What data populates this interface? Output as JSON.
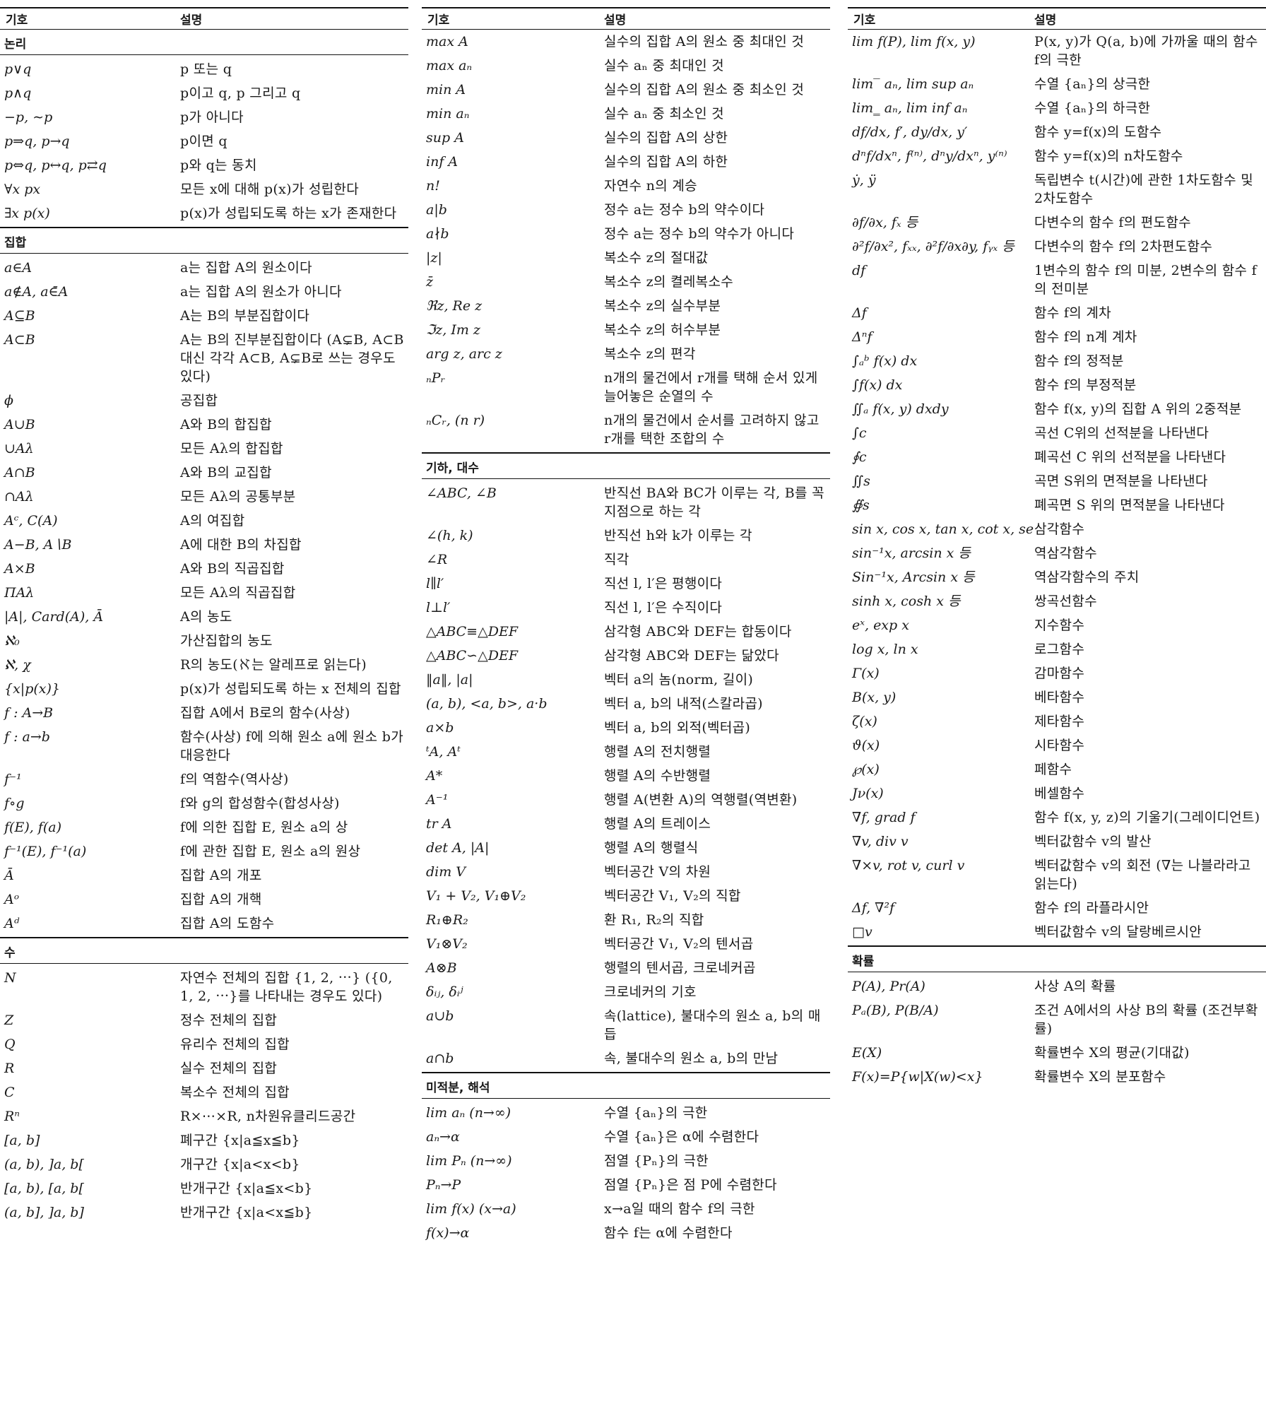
{
  "header": {
    "symbol_label": "기호",
    "desc_label": "설명"
  },
  "columns": [
    {
      "sections": [
        {
          "title": "논리",
          "rows": [
            {
              "sym": "p∨q",
              "desc": "p 또는 q"
            },
            {
              "sym": "p∧q",
              "desc": "p이고 q, p 그리고 q"
            },
            {
              "sym": "−p, ∼p",
              "desc": "p가 아니다"
            },
            {
              "sym": "p⇒q, p→q",
              "desc": "p이면 q"
            },
            {
              "sym": "p⇔q, p↔q, p⇄q",
              "desc": "p와 q는 동치"
            },
            {
              "sym": "∀x px",
              "desc": "모든 x에 대해 p(x)가 성립한다"
            },
            {
              "sym": "∃x p(x)",
              "desc": "p(x)가 성립되도록 하는 x가 존재한다"
            }
          ]
        },
        {
          "title": "집합",
          "rows": [
            {
              "sym": "a∈A",
              "desc": "a는 집합 A의 원소이다"
            },
            {
              "sym": "a∉A, a∈̄A",
              "desc": "a는 집합 A의 원소가 아니다"
            },
            {
              "sym": "A⊆B",
              "desc": "A는 B의 부분집합이다"
            },
            {
              "sym": "A⊂B",
              "desc": "A는 B의 진부분집합이다 (A⊊B, A⊂B 대신 각각 A⊂B, A⊊B로 쓰는 경우도 있다)"
            },
            {
              "sym": "ϕ",
              "desc": "공집합"
            },
            {
              "sym": "A∪B",
              "desc": "A와 B의 합집합"
            },
            {
              "sym": "∪Aλ",
              "desc": "모든 Aλ의 합집합"
            },
            {
              "sym": "A∩B",
              "desc": "A와 B의 교집합"
            },
            {
              "sym": "∩Aλ",
              "desc": "모든 Aλ의 공통부분"
            },
            {
              "sym": "Aᶜ, C(A)",
              "desc": "A의 여집합"
            },
            {
              "sym": "A−B, A∖B",
              "desc": "A에 대한 B의 차집합"
            },
            {
              "sym": "A×B",
              "desc": "A와 B의 직곱집합"
            },
            {
              "sym": "ΠAλ",
              "desc": "모든 Aλ의 직곱집합"
            },
            {
              "sym": "|A|, Card(A), Ā",
              "desc": "A의 농도"
            },
            {
              "sym": "ℵ₀",
              "desc": "가산집합의 농도"
            },
            {
              "sym": "ℵ, χ",
              "desc": "R의 농도(ℵ는 알레프로 읽는다)"
            },
            {
              "sym": "{x|p(x)}",
              "desc": "p(x)가 성립되도록 하는 x 전체의 집합"
            },
            {
              "sym": "f : A→B",
              "desc": "집합 A에서 B로의 함수(사상)"
            },
            {
              "sym": "f : a→b",
              "desc": "함수(사상) f에 의해 원소 a에 원소 b가 대응한다"
            },
            {
              "sym": "f⁻¹",
              "desc": "f의 역함수(역사상)"
            },
            {
              "sym": "f∘g",
              "desc": "f와 g의 합성함수(합성사상)"
            },
            {
              "sym": "f(E), f(a)",
              "desc": "f에 의한 집합 E, 원소 a의 상"
            },
            {
              "sym": "f⁻¹(E), f⁻¹(a)",
              "desc": "f에 관한 집합 E, 원소 a의 원상"
            },
            {
              "sym": "Ā",
              "desc": "집합 A의 개포"
            },
            {
              "sym": "Aᵒ",
              "desc": "집합 A의 개핵"
            },
            {
              "sym": "Aᵈ",
              "desc": "집합 A의 도함수"
            }
          ]
        },
        {
          "title": "수",
          "rows": [
            {
              "sym": "N",
              "desc": "자연수 전체의 집합 {1, 2, ⋯} ({0, 1, 2, ⋯}를 나타내는 경우도 있다)"
            },
            {
              "sym": "Z",
              "desc": "정수 전체의 집합"
            },
            {
              "sym": "Q",
              "desc": "유리수 전체의 집합"
            },
            {
              "sym": "R",
              "desc": "실수 전체의 집합"
            },
            {
              "sym": "C",
              "desc": "복소수 전체의 집합"
            },
            {
              "sym": "Rⁿ",
              "desc": "R×⋯×R, n차원유클리드공간"
            },
            {
              "sym": "[a, b]",
              "desc": "폐구간 {x|a≦x≦b}"
            },
            {
              "sym": "(a, b), ]a, b[",
              "desc": "개구간 {x|a<x<b}"
            },
            {
              "sym": "[a, b), [a, b[",
              "desc": "반개구간 {x|a≦x<b}"
            },
            {
              "sym": "(a, b], ]a, b]",
              "desc": "반개구간 {x|a<x≦b}"
            }
          ]
        }
      ]
    },
    {
      "sections": [
        {
          "title": "",
          "rows": [
            {
              "sym": "max A",
              "desc": "실수의 집합 A의 원소 중 최대인 것"
            },
            {
              "sym": "max aₙ",
              "desc": "실수 aₙ 중 최대인 것"
            },
            {
              "sym": "min A",
              "desc": "실수의 집합 A의 원소 중 최소인 것"
            },
            {
              "sym": "min aₙ",
              "desc": "실수 aₙ 중 최소인 것"
            },
            {
              "sym": "sup A",
              "desc": "실수의 집합 A의 상한"
            },
            {
              "sym": "inf A",
              "desc": "실수의 집합 A의 하한"
            },
            {
              "sym": "n!",
              "desc": "자연수 n의 계승"
            },
            {
              "sym": "a|b",
              "desc": "정수 a는 정수 b의 약수이다"
            },
            {
              "sym": "a∤b",
              "desc": "정수 a는 정수 b의 약수가 아니다"
            },
            {
              "sym": "|z|",
              "desc": "복소수 z의 절대값"
            },
            {
              "sym": "z̄",
              "desc": "복소수 z의 켤레복소수"
            },
            {
              "sym": "ℜz, Re z",
              "desc": "복소수 z의 실수부분"
            },
            {
              "sym": "ℑz, Im z",
              "desc": "복소수 z의 허수부분"
            },
            {
              "sym": "arg z, arc z",
              "desc": "복소수 z의 편각"
            },
            {
              "sym": "ₙPᵣ",
              "desc": "n개의 물건에서 r개를 택해 순서 있게 늘어놓은 순열의 수"
            },
            {
              "sym": "ₙCᵣ, (n r)",
              "desc": "n개의 물건에서 순서를 고려하지 않고 r개를 택한 조합의 수"
            }
          ]
        },
        {
          "title": "기하, 대수",
          "rows": [
            {
              "sym": "∠ABC, ∠B",
              "desc": "반직선 BA와 BC가 이루는 각, B를 꼭지점으로 하는 각"
            },
            {
              "sym": "∠(h, k)",
              "desc": "반직선 h와 k가 이루는 각"
            },
            {
              "sym": "∠R",
              "desc": "직각"
            },
            {
              "sym": "l∥l′",
              "desc": "직선 l, l′은 평행이다"
            },
            {
              "sym": "l⊥l′",
              "desc": "직선 l, l′은 수직이다"
            },
            {
              "sym": "△ABC≡△DEF",
              "desc": "삼각형 ABC와 DEF는 합동이다"
            },
            {
              "sym": "△ABC∽△DEF",
              "desc": "삼각형 ABC와 DEF는 닮았다"
            },
            {
              "sym": "‖a‖, |a|",
              "desc": "벡터 a의 놈(norm, 길이)"
            },
            {
              "sym": "(a, b), <a, b>, a·b",
              "desc": "벡터 a, b의 내적(스칼라곱)"
            },
            {
              "sym": "a×b",
              "desc": "벡터 a, b의 외적(벡터곱)"
            },
            {
              "sym": "ᵗA, Aᵗ",
              "desc": "행렬 A의 전치행렬"
            },
            {
              "sym": "A*",
              "desc": "행렬 A의 수반행렬"
            },
            {
              "sym": "A⁻¹",
              "desc": "행렬 A(변환 A)의 역행렬(역변환)"
            },
            {
              "sym": "tr A",
              "desc": "행렬 A의 트레이스"
            },
            {
              "sym": "det A, |A|",
              "desc": "행렬 A의 행렬식"
            },
            {
              "sym": "dim V",
              "desc": "벡터공간 V의 차원"
            },
            {
              "sym": "V₁ + V₂, V₁⊕V₂",
              "desc": "벡터공간 V₁, V₂의 직합"
            },
            {
              "sym": "R₁⊕R₂",
              "desc": "환 R₁, R₂의 직합"
            },
            {
              "sym": "V₁⊗V₂",
              "desc": "벡터공간 V₁, V₂의 텐서곱"
            },
            {
              "sym": "A⊗B",
              "desc": "행렬의 텐서곱, 크로네커곱"
            },
            {
              "sym": "δᵢⱼ, δᵢʲ",
              "desc": "크로네커의 기호"
            },
            {
              "sym": "a∪b",
              "desc": "속(lattice), 불대수의 원소 a, b의 매듭"
            },
            {
              "sym": "a∩b",
              "desc": "속, 불대수의 원소 a, b의 만남"
            }
          ]
        },
        {
          "title": "미적분, 해석",
          "rows": [
            {
              "sym": "lim aₙ (n→∞)",
              "desc": "수열 {aₙ}의 극한"
            },
            {
              "sym": "aₙ→α",
              "desc": "수열 {aₙ}은 α에 수렴한다"
            },
            {
              "sym": "lim Pₙ (n→∞)",
              "desc": "점열 {Pₙ}의 극한"
            },
            {
              "sym": "Pₙ→P",
              "desc": "점열 {Pₙ}은 점 P에 수렴한다"
            },
            {
              "sym": "lim f(x) (x→a)",
              "desc": "x→a일 때의 함수 f의 극한"
            },
            {
              "sym": "f(x)→α",
              "desc": "함수 f는 α에 수렴한다"
            }
          ]
        }
      ]
    },
    {
      "sections": [
        {
          "title": "",
          "rows": [
            {
              "sym": "lim f(P), lim f(x, y)",
              "desc": "P(x, y)가 Q(a, b)에 가까울 때의 함수 f의 극한"
            },
            {
              "sym": "lim‾ aₙ, lim sup aₙ",
              "desc": "수열 {aₙ}의 상극한"
            },
            {
              "sym": "lim‗ aₙ, lim inf aₙ",
              "desc": "수열 {aₙ}의 하극한"
            },
            {
              "sym": "df/dx, f′, dy/dx, y′",
              "desc": "함수 y=f(x)의 도함수"
            },
            {
              "sym": "dⁿf/dxⁿ, f⁽ⁿ⁾, dⁿy/dxⁿ, y⁽ⁿ⁾",
              "desc": "함수 y=f(x)의 n차도함수"
            },
            {
              "sym": "ẏ, ÿ",
              "desc": "독립변수 t(시간)에 관한 1차도함수 및 2차도함수"
            },
            {
              "sym": "∂f/∂x, fₓ 등",
              "desc": "다변수의 함수 f의 편도함수"
            },
            {
              "sym": "∂²f/∂x², fₓₓ, ∂²f/∂x∂y, fᵧₓ 등",
              "desc": "다변수의 함수 f의 2차편도함수"
            },
            {
              "sym": "df",
              "desc": "1변수의 함수 f의 미분, 2변수의 함수 f의 전미분"
            },
            {
              "sym": "Δf",
              "desc": "함수 f의 계차"
            },
            {
              "sym": "Δⁿf",
              "desc": "함수 f의 n계 계차"
            },
            {
              "sym": "∫ₐᵇ f(x) dx",
              "desc": "함수 f의 정적분"
            },
            {
              "sym": "∫f(x) dx",
              "desc": "함수 f의 부정적분"
            },
            {
              "sym": "∬ₐ f(x, y) dxdy",
              "desc": "함수 f(x, y)의 집합 A 위의 2중적분"
            },
            {
              "sym": "∫c",
              "desc": "곡선 C위의 선적분을 나타낸다"
            },
            {
              "sym": "∮c",
              "desc": "폐곡선 C 위의 선적분을 나타낸다"
            },
            {
              "sym": "∬s",
              "desc": "곡면 S위의 면적분을 나타낸다"
            },
            {
              "sym": "∯s",
              "desc": "폐곡면 S 위의 면적분을 나타낸다"
            },
            {
              "sym": "sin x, cos x, tan x, cot x, sec x, cosec x",
              "desc": "삼각함수"
            },
            {
              "sym": "sin⁻¹x, arcsin x 등",
              "desc": "역삼각함수"
            },
            {
              "sym": "Sin⁻¹x, Arcsin x 등",
              "desc": "역삼각함수의 주치"
            },
            {
              "sym": "sinh x, cosh x 등",
              "desc": "쌍곡선함수"
            },
            {
              "sym": "eˣ, exp x",
              "desc": "지수함수"
            },
            {
              "sym": "log x, ln x",
              "desc": "로그함수"
            },
            {
              "sym": "Γ(x)",
              "desc": "감마함수"
            },
            {
              "sym": "B(x, y)",
              "desc": "베타함수"
            },
            {
              "sym": "ζ(x)",
              "desc": "제타함수"
            },
            {
              "sym": "ϑ(x)",
              "desc": "시타함수"
            },
            {
              "sym": "℘(x)",
              "desc": "페함수"
            },
            {
              "sym": "Jν(x)",
              "desc": "베셀함수"
            },
            {
              "sym": "∇f, grad f",
              "desc": "함수 f(x, y, z)의 기울기(그레이디언트)"
            },
            {
              "sym": "∇v, div v",
              "desc": "벡터값함수 v의 발산"
            },
            {
              "sym": "∇×v, rot v, curl v",
              "desc": "벡터값함수 v의 회전 (∇는 나블라라고 읽는다)"
            },
            {
              "sym": "Δf, ∇²f",
              "desc": "함수 f의 라플라시안"
            },
            {
              "sym": "□v",
              "desc": "벡터값함수 v의 달랑베르시안"
            }
          ]
        },
        {
          "title": "확률",
          "rows": [
            {
              "sym": "P(A), Pr(A)",
              "desc": "사상 A의 확률"
            },
            {
              "sym": "Pₐ(B), P(B/A)",
              "desc": "조건 A에서의 사상 B의 확률 (조건부확률)"
            },
            {
              "sym": "E(X)",
              "desc": "확률변수 X의 평균(기대값)"
            },
            {
              "sym": "F(x)=P{w|X(w)<x}",
              "desc": "확률변수 X의 분포함수"
            }
          ]
        }
      ]
    }
  ]
}
